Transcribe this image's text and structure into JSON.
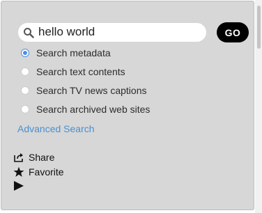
{
  "search": {
    "value": "hello world",
    "go_label": "GO"
  },
  "options": [
    {
      "label": "Search metadata",
      "checked": true
    },
    {
      "label": "Search text contents",
      "checked": false
    },
    {
      "label": "Search TV news captions",
      "checked": false
    },
    {
      "label": "Search archived web sites",
      "checked": false
    }
  ],
  "advanced_search_label": "Advanced Search",
  "actions": {
    "share_label": "Share",
    "favorite_label": "Favorite"
  },
  "colors": {
    "accent": "#4a90e2",
    "link": "#4a8fd0",
    "panel": "#d7d7d7"
  },
  "icons": {
    "search": "magnifier-icon",
    "share": "share-icon",
    "favorite": "star-icon",
    "play": "play-icon"
  }
}
